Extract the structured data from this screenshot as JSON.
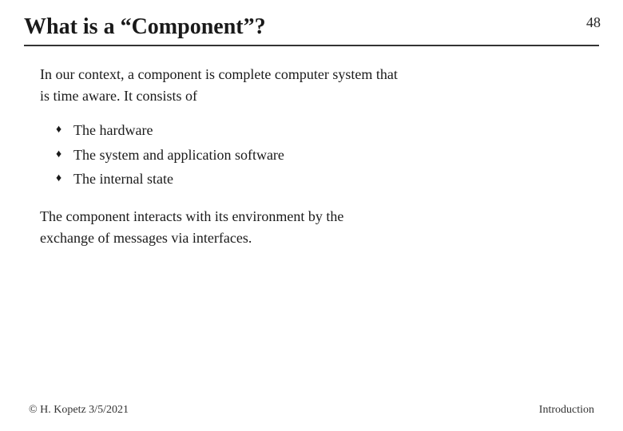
{
  "slide_number": "48",
  "title": "What is a “Component”?",
  "intro_text_line1": "In our context, a component is complete computer system that",
  "intro_text_line2": "is time aware.  It consists of",
  "bullets": [
    "The hardware",
    "The system and application software",
    "The internal state"
  ],
  "conclusion_line1": "The component interacts with its environment by the",
  "conclusion_line2": "exchange of messages via interfaces.",
  "footer": {
    "left": "© H. Kopetz  3/5/2021",
    "right": "Introduction"
  }
}
